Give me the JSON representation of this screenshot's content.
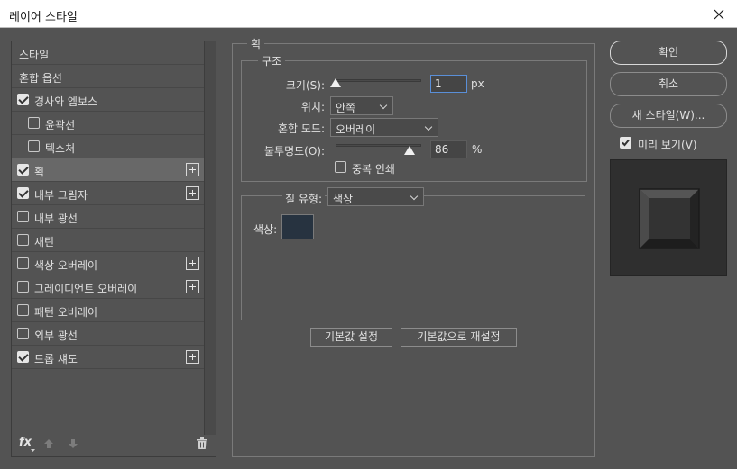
{
  "window": {
    "title": "레이어 스타일"
  },
  "sidebar": {
    "items": [
      {
        "label": "스타일",
        "has_check": false,
        "checked": false,
        "has_plus": false,
        "selected": false
      },
      {
        "label": "혼합 옵션",
        "has_check": false,
        "checked": false,
        "has_plus": false,
        "selected": false
      },
      {
        "label": "경사와 엠보스",
        "has_check": true,
        "checked": true,
        "has_plus": false,
        "selected": false
      },
      {
        "label": "윤곽선",
        "has_check": true,
        "checked": false,
        "has_plus": false,
        "selected": false,
        "indent": true
      },
      {
        "label": "텍스처",
        "has_check": true,
        "checked": false,
        "has_plus": false,
        "selected": false,
        "indent": true
      },
      {
        "label": "획",
        "has_check": true,
        "checked": true,
        "has_plus": true,
        "selected": true
      },
      {
        "label": "내부 그림자",
        "has_check": true,
        "checked": true,
        "has_plus": true,
        "selected": false
      },
      {
        "label": "내부 광선",
        "has_check": true,
        "checked": false,
        "has_plus": false,
        "selected": false
      },
      {
        "label": "새틴",
        "has_check": true,
        "checked": false,
        "has_plus": false,
        "selected": false
      },
      {
        "label": "색상 오버레이",
        "has_check": true,
        "checked": false,
        "has_plus": true,
        "selected": false
      },
      {
        "label": "그레이디언트 오버레이",
        "has_check": true,
        "checked": false,
        "has_plus": true,
        "selected": false
      },
      {
        "label": "패턴 오버레이",
        "has_check": true,
        "checked": false,
        "has_plus": false,
        "selected": false
      },
      {
        "label": "외부 광선",
        "has_check": true,
        "checked": false,
        "has_plus": false,
        "selected": false
      },
      {
        "label": "드롭 섀도",
        "has_check": true,
        "checked": true,
        "has_plus": true,
        "selected": false
      }
    ],
    "fx_label": "fx"
  },
  "stroke": {
    "title": "획",
    "structure": {
      "title": "구조",
      "size_label": "크기(S):",
      "size_value": "1",
      "size_unit": "px",
      "size_fraction": 0.0,
      "position_label": "위치:",
      "position_value": "안쪽",
      "blend_label": "혼합 모드:",
      "blend_value": "오버레이",
      "opacity_label": "불투명도(O):",
      "opacity_value": "86",
      "opacity_unit": "%",
      "opacity_fraction": 0.86,
      "overprint_label": "중복 인쇄"
    },
    "fill": {
      "type_label": "칠 유형:",
      "type_value": "색상",
      "color_label": "색상:",
      "color": "#273340"
    },
    "default_button": "기본값 설정",
    "reset_button": "기본값으로 재설정"
  },
  "actions": {
    "ok": "확인",
    "cancel": "취소",
    "new_style": "새 스타일(W)...",
    "preview_label": "미리 보기(V)",
    "preview_checked": true
  }
}
